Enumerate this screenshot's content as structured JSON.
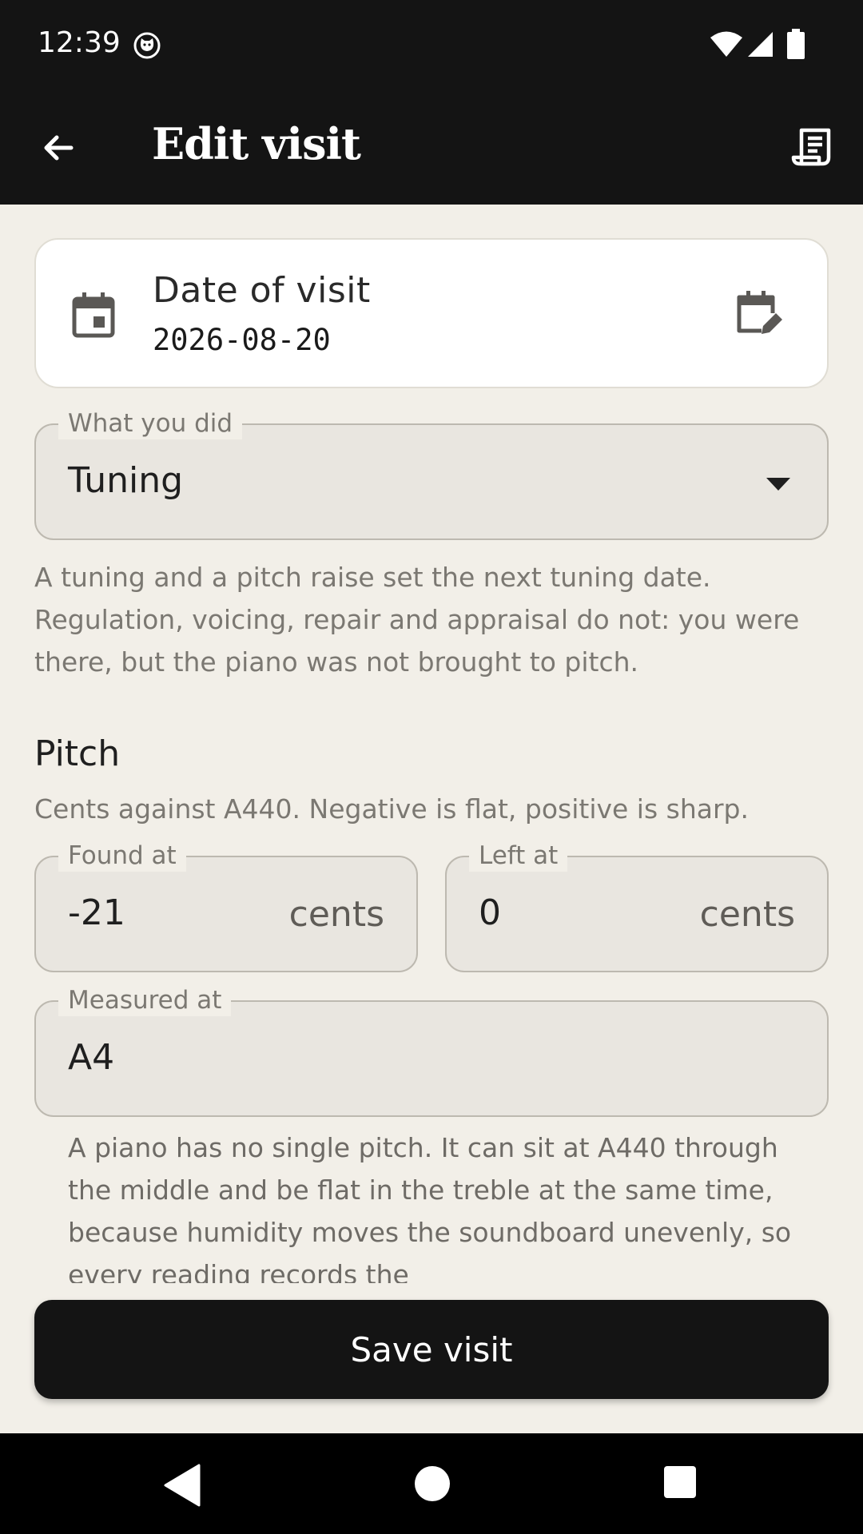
{
  "status_bar": {
    "time": "12:39",
    "icons": [
      "cat-notification-icon",
      "wifi-icon",
      "signal-icon",
      "battery-icon"
    ]
  },
  "app_bar": {
    "title": "Edit visit",
    "back_icon": "arrow-back-icon",
    "action_icon": "receipt-icon"
  },
  "date_card": {
    "label": "Date of visit",
    "value": "2026-08-20",
    "icon": "calendar-icon",
    "edit_icon": "calendar-edit-icon"
  },
  "service": {
    "label": "What you did",
    "value": "Tuning",
    "helper": "A tuning and a pitch raise set the next tuning date. Regulation, voicing, repair and appraisal do not: you were there, but the piano was not brought to pitch."
  },
  "pitch": {
    "title": "Pitch",
    "subtitle": "Cents against A440. Negative is flat, positive is sharp.",
    "found_label": "Found at",
    "found_value": "-21",
    "found_suffix": "cents",
    "left_label": "Left at",
    "left_value": "0",
    "left_suffix": "cents",
    "measured_label": "Measured at",
    "measured_value": "A4",
    "note": "A piano has no single pitch. It can sit at A440 through the middle and be flat in the treble at the same time, because humidity moves the soundboard unevenly, so every reading records the"
  },
  "actions": {
    "save_label": "Save visit"
  },
  "colors": {
    "bar": "#141414",
    "background": "#f2efe8",
    "field_fill": "#e9e6e0",
    "helper_text": "#7b7872"
  }
}
